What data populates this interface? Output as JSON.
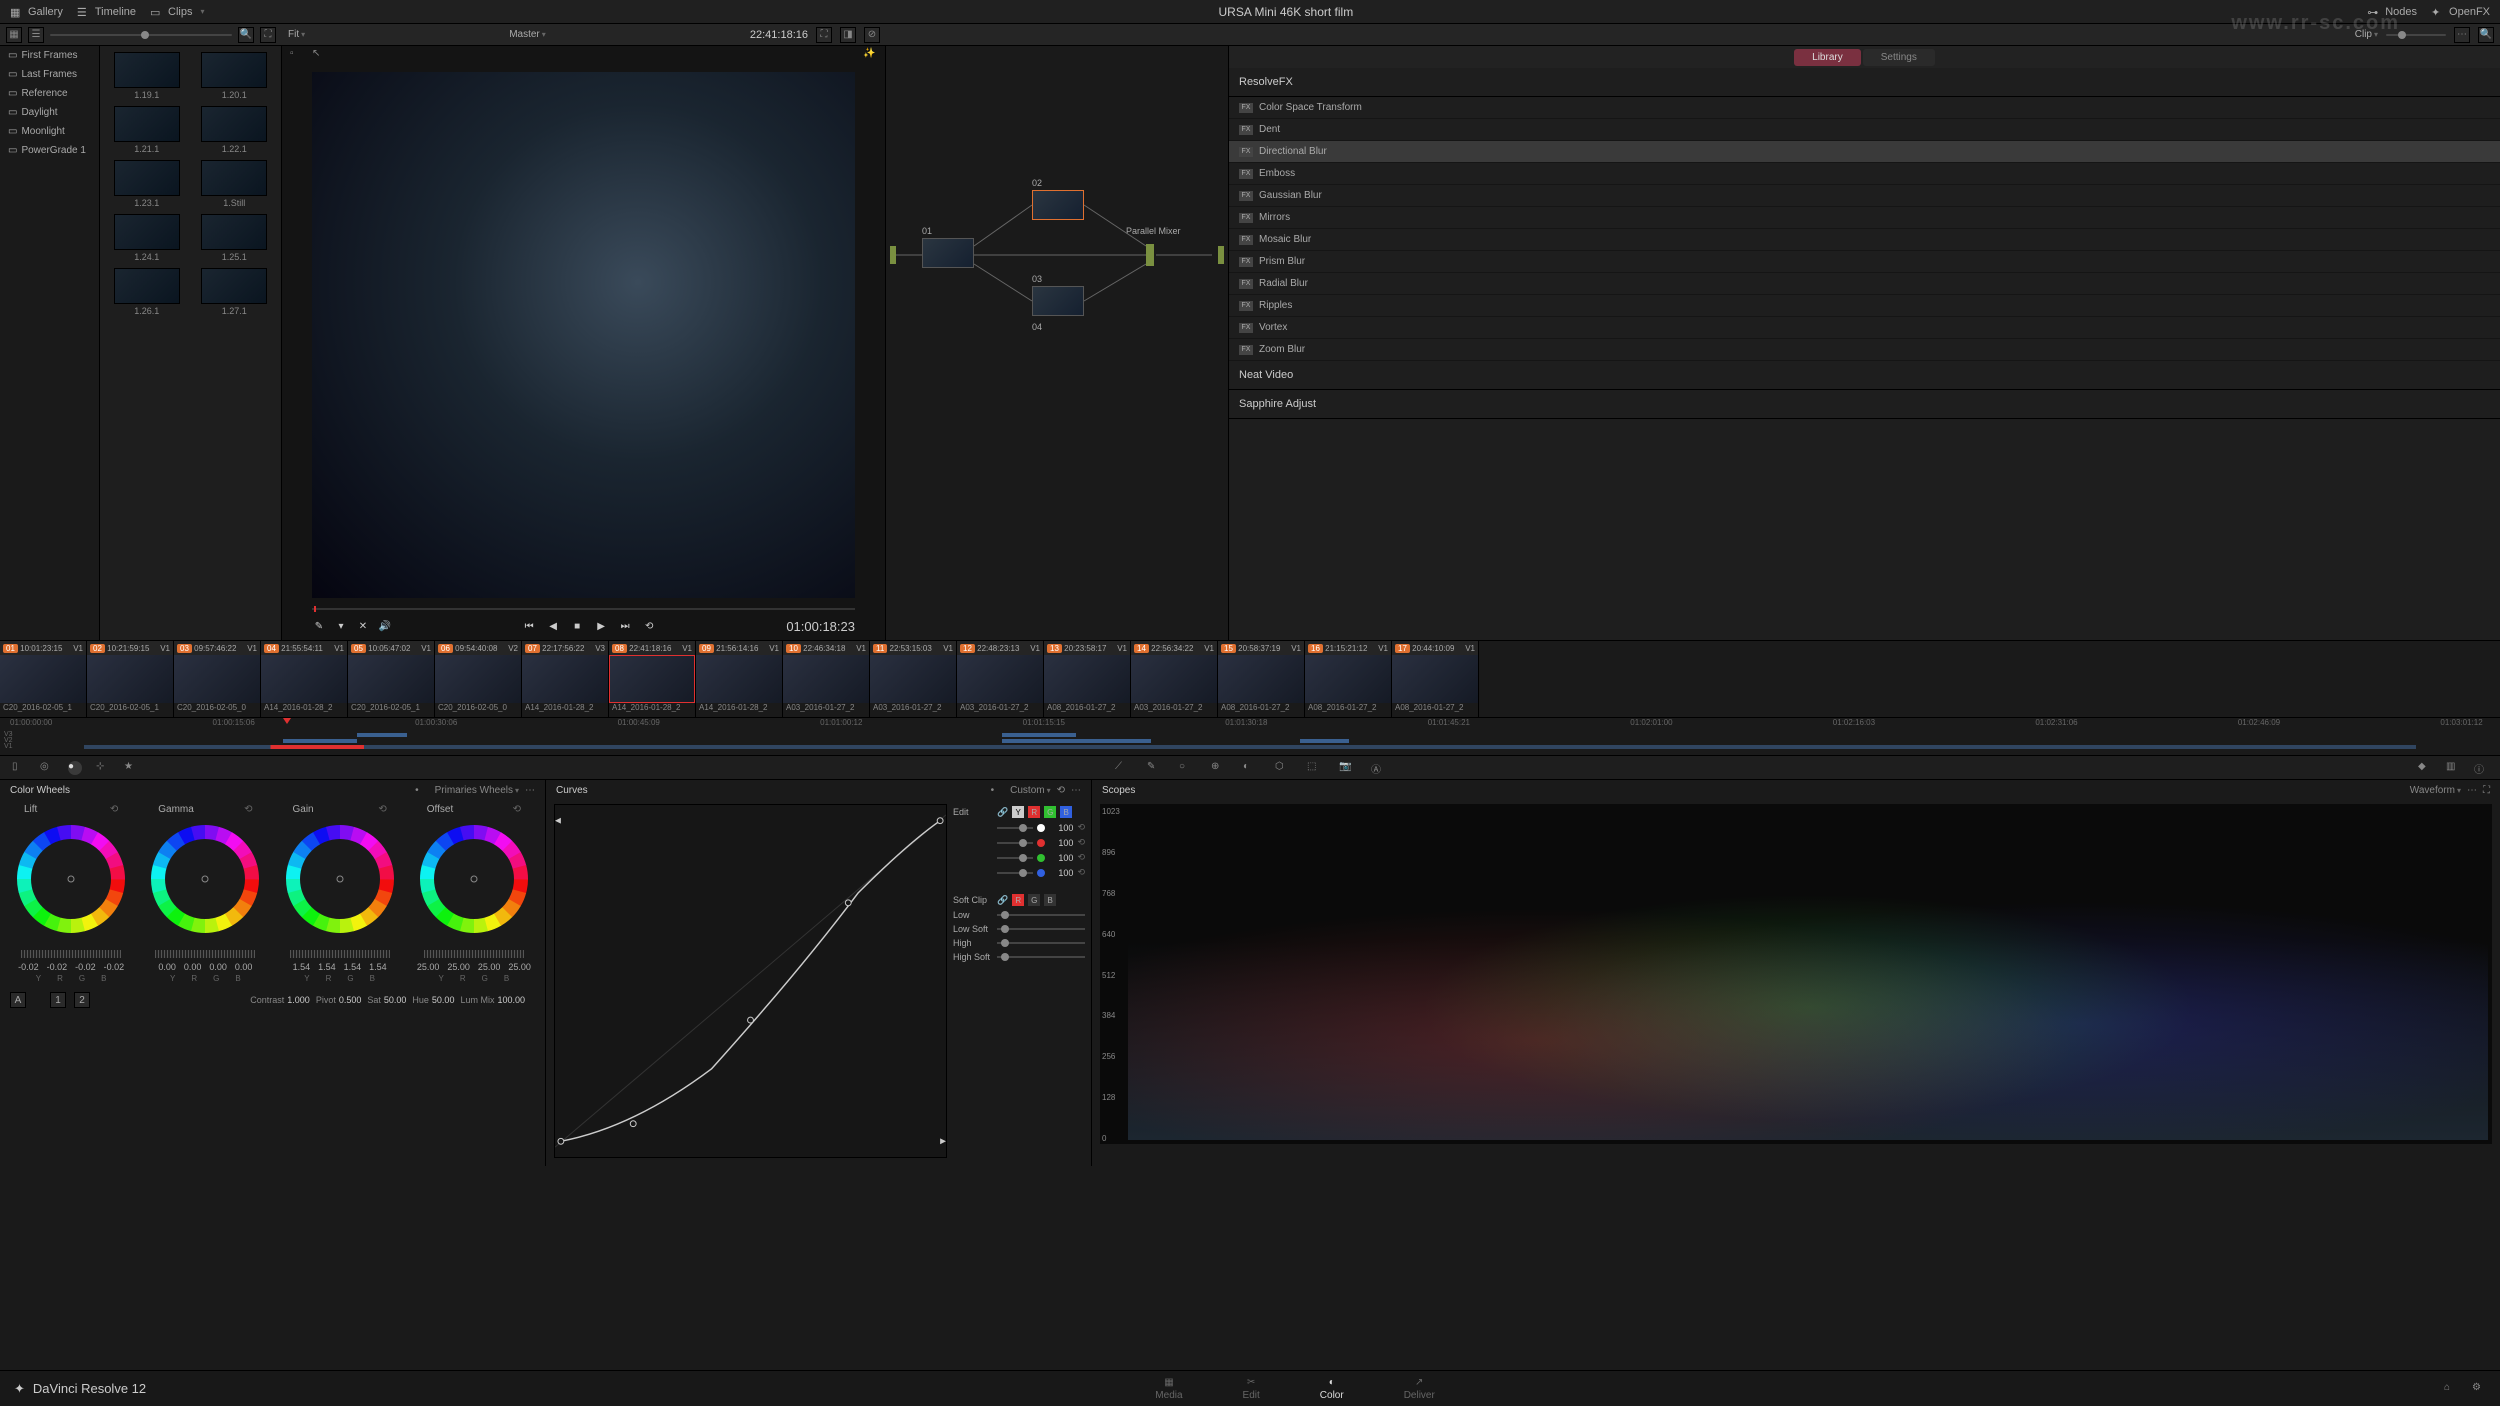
{
  "project_title": "URSA Mini 46K short film",
  "top_buttons": {
    "gallery": "Gallery",
    "timeline": "Timeline",
    "clips": "Clips",
    "nodes": "Nodes",
    "openfx": "OpenFX"
  },
  "viewer_bar": {
    "fit": "Fit",
    "master": "Master",
    "timecode": "22:41:18:16",
    "clip": "Clip"
  },
  "gallery_albums": [
    "First Frames",
    "Last Frames",
    "Reference",
    "Daylight",
    "Moonlight",
    "PowerGrade 1"
  ],
  "thumbs": [
    {
      "l": "1.19.1"
    },
    {
      "l": "1.20.1"
    },
    {
      "l": "1.21.1"
    },
    {
      "l": "1.22.1"
    },
    {
      "l": "1.23.1"
    },
    {
      "l": "1.Still"
    },
    {
      "l": "1.24.1"
    },
    {
      "l": "1.25.1"
    },
    {
      "l": "1.26.1"
    },
    {
      "l": "1.27.1"
    }
  ],
  "viewer_tc": "01:00:18:23",
  "nodes": {
    "n01": "01",
    "n02": "02",
    "n03": "03",
    "n04": "04",
    "mixer": "Parallel Mixer"
  },
  "fx": {
    "tabs": {
      "library": "Library",
      "settings": "Settings"
    },
    "group1": "ResolveFX",
    "list1": [
      "Color Space Transform",
      "Dent",
      "Directional Blur",
      "Emboss",
      "Gaussian Blur",
      "Mirrors",
      "Mosaic Blur",
      "Prism Blur",
      "Radial Blur",
      "Ripples",
      "Vortex",
      "Zoom Blur"
    ],
    "group2": "Neat Video",
    "group3": "Sapphire Adjust"
  },
  "clips": [
    {
      "n": "01",
      "tc": "10:01:23:15",
      "v": "V1",
      "name": "C20_2016-02-05_1"
    },
    {
      "n": "02",
      "tc": "10:21:59:15",
      "v": "V1",
      "name": "C20_2016-02-05_1"
    },
    {
      "n": "03",
      "tc": "09:57:46:22",
      "v": "V1",
      "name": "C20_2016-02-05_0"
    },
    {
      "n": "04",
      "tc": "21:55:54:11",
      "v": "V1",
      "name": "A14_2016-01-28_2"
    },
    {
      "n": "05",
      "tc": "10:05:47:02",
      "v": "V1",
      "name": "C20_2016-02-05_1"
    },
    {
      "n": "06",
      "tc": "09:54:40:08",
      "v": "V2",
      "name": "C20_2016-02-05_0"
    },
    {
      "n": "07",
      "tc": "22:17:56:22",
      "v": "V3",
      "name": "A14_2016-01-28_2"
    },
    {
      "n": "08",
      "tc": "22:41:18:16",
      "v": "V1",
      "name": "A14_2016-01-28_2",
      "sel": true
    },
    {
      "n": "09",
      "tc": "21:56:14:16",
      "v": "V1",
      "name": "A14_2016-01-28_2"
    },
    {
      "n": "10",
      "tc": "22:46:34:18",
      "v": "V1",
      "name": "A03_2016-01-27_2"
    },
    {
      "n": "11",
      "tc": "22:53:15:03",
      "v": "V1",
      "name": "A03_2016-01-27_2"
    },
    {
      "n": "12",
      "tc": "22:48:23:13",
      "v": "V1",
      "name": "A03_2016-01-27_2"
    },
    {
      "n": "13",
      "tc": "20:23:58:17",
      "v": "V1",
      "name": "A08_2016-01-27_2"
    },
    {
      "n": "14",
      "tc": "22:56:34:22",
      "v": "V1",
      "name": "A03_2016-01-27_2"
    },
    {
      "n": "15",
      "tc": "20:58:37:19",
      "v": "V1",
      "name": "A08_2016-01-27_2"
    },
    {
      "n": "16",
      "tc": "21:15:21:12",
      "v": "V1",
      "name": "A08_2016-01-27_2"
    },
    {
      "n": "17",
      "tc": "20:44:10:09",
      "v": "V1",
      "name": "A08_2016-01-27_2"
    }
  ],
  "timeline_marks": [
    "01:00:00:00",
    "01:00:15:06",
    "01:00:30:06",
    "01:00:45:09",
    "01:01:00:12",
    "01:01:15:15",
    "01:01:30:18",
    "01:01:45:21",
    "01:02:01:00",
    "01:02:16:03",
    "01:02:31:06",
    "01:02:46:09",
    "01:03:01:12"
  ],
  "track_labels": [
    "V3",
    "V2",
    "V1"
  ],
  "wheels": {
    "title": "Color Wheels",
    "dropdown": "Primaries Wheels",
    "cells": [
      {
        "label": "Lift",
        "nums": [
          "-0.02",
          "-0.02",
          "-0.02",
          "-0.02"
        ]
      },
      {
        "label": "Gamma",
        "nums": [
          "0.00",
          "0.00",
          "0.00",
          "0.00"
        ]
      },
      {
        "label": "Gain",
        "nums": [
          "1.54",
          "1.54",
          "1.54",
          "1.54"
        ]
      },
      {
        "label": "Offset",
        "nums": [
          "25.00",
          "25.00",
          "25.00",
          "25.00"
        ]
      }
    ],
    "letters": [
      "Y",
      "R",
      "G",
      "B"
    ],
    "row_letters": [
      "A",
      "1",
      "2"
    ],
    "adjust": [
      {
        "l": "Contrast",
        "v": "1.000"
      },
      {
        "l": "Pivot",
        "v": "0.500"
      },
      {
        "l": "Sat",
        "v": "50.00"
      },
      {
        "l": "Hue",
        "v": "50.00"
      },
      {
        "l": "Lum Mix",
        "v": "100.00"
      }
    ]
  },
  "curves": {
    "title": "Curves",
    "dropdown": "Custom",
    "edit": "Edit",
    "chans": [
      "Y",
      "R",
      "G",
      "B"
    ],
    "vals": [
      {
        "c": "#fff",
        "v": "100"
      },
      {
        "c": "#e03030",
        "v": "100"
      },
      {
        "c": "#30c030",
        "v": "100"
      },
      {
        "c": "#3060e0",
        "v": "100"
      }
    ],
    "soft": "Soft Clip",
    "soft_rows": [
      "Low",
      "Low Soft",
      "High",
      "High Soft"
    ]
  },
  "scopes": {
    "title": "Scopes",
    "dropdown": "Waveform",
    "scale": [
      "1023",
      "896",
      "768",
      "640",
      "512",
      "384",
      "256",
      "128",
      "0"
    ]
  },
  "pages": [
    "Media",
    "Edit",
    "Color",
    "Deliver"
  ],
  "app_name": "DaVinci Resolve 12",
  "watermark": "www.rr-sc.com"
}
